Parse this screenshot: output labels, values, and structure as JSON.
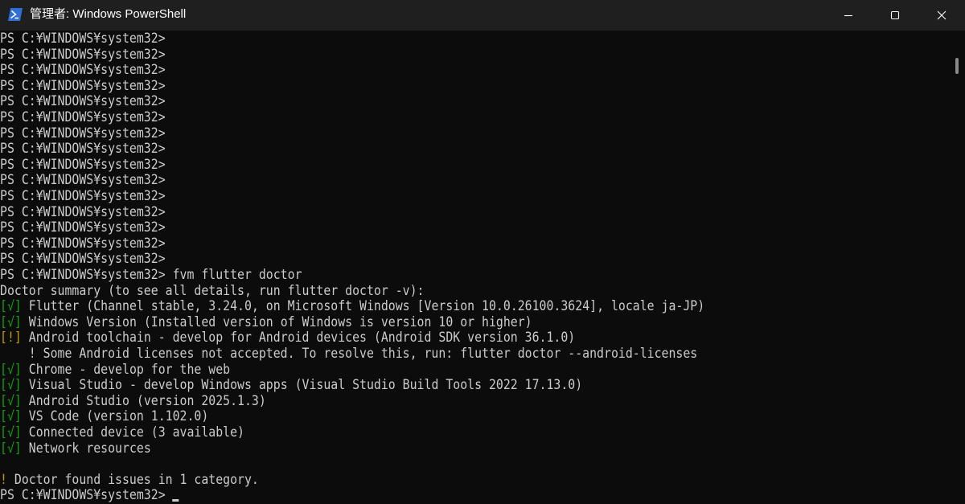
{
  "window": {
    "title": "管理者: Windows PowerShell"
  },
  "console": {
    "prompt": "PS C:¥WINDOWS¥system32>",
    "empty_prompt_count": 15,
    "command": "fvm flutter doctor",
    "summary": "Doctor summary (to see all details, run flutter doctor -v):",
    "checks": [
      {
        "mark": "[√]",
        "status": "ok",
        "text": "Flutter (Channel stable, 3.24.0, on Microsoft Windows [Version 10.0.26100.3624], locale ja-JP)"
      },
      {
        "mark": "[√]",
        "status": "ok",
        "text": "Windows Version (Installed version of Windows is version 10 or higher)"
      },
      {
        "mark": "[!]",
        "status": "warn",
        "text": "Android toolchain - develop for Android devices (Android SDK version 36.1.0)"
      },
      {
        "mark": "",
        "status": "note",
        "text": "    ! Some Android licenses not accepted. To resolve this, run: flutter doctor --android-licenses"
      },
      {
        "mark": "[√]",
        "status": "ok",
        "text": "Chrome - develop for the web"
      },
      {
        "mark": "[√]",
        "status": "ok",
        "text": "Visual Studio - develop Windows apps (Visual Studio Build Tools 2022 17.13.0)"
      },
      {
        "mark": "[√]",
        "status": "ok",
        "text": "Android Studio (version 2025.1.3)"
      },
      {
        "mark": "[√]",
        "status": "ok",
        "text": "VS Code (version 1.102.0)"
      },
      {
        "mark": "[√]",
        "status": "ok",
        "text": "Connected device (3 available)"
      },
      {
        "mark": "[√]",
        "status": "ok",
        "text": "Network resources"
      }
    ],
    "issues_mark": "!",
    "issues_text": " Doctor found issues in 1 category."
  },
  "colors": {
    "background": "#0c0c0c",
    "titlebar": "#1f1f1f",
    "foreground": "#cccccc",
    "ok": "#13a10e",
    "warn": "#c19c00"
  },
  "icons": {
    "app": "powershell-icon",
    "minimize": "minimize-icon",
    "maximize": "maximize-icon",
    "close": "close-icon"
  }
}
